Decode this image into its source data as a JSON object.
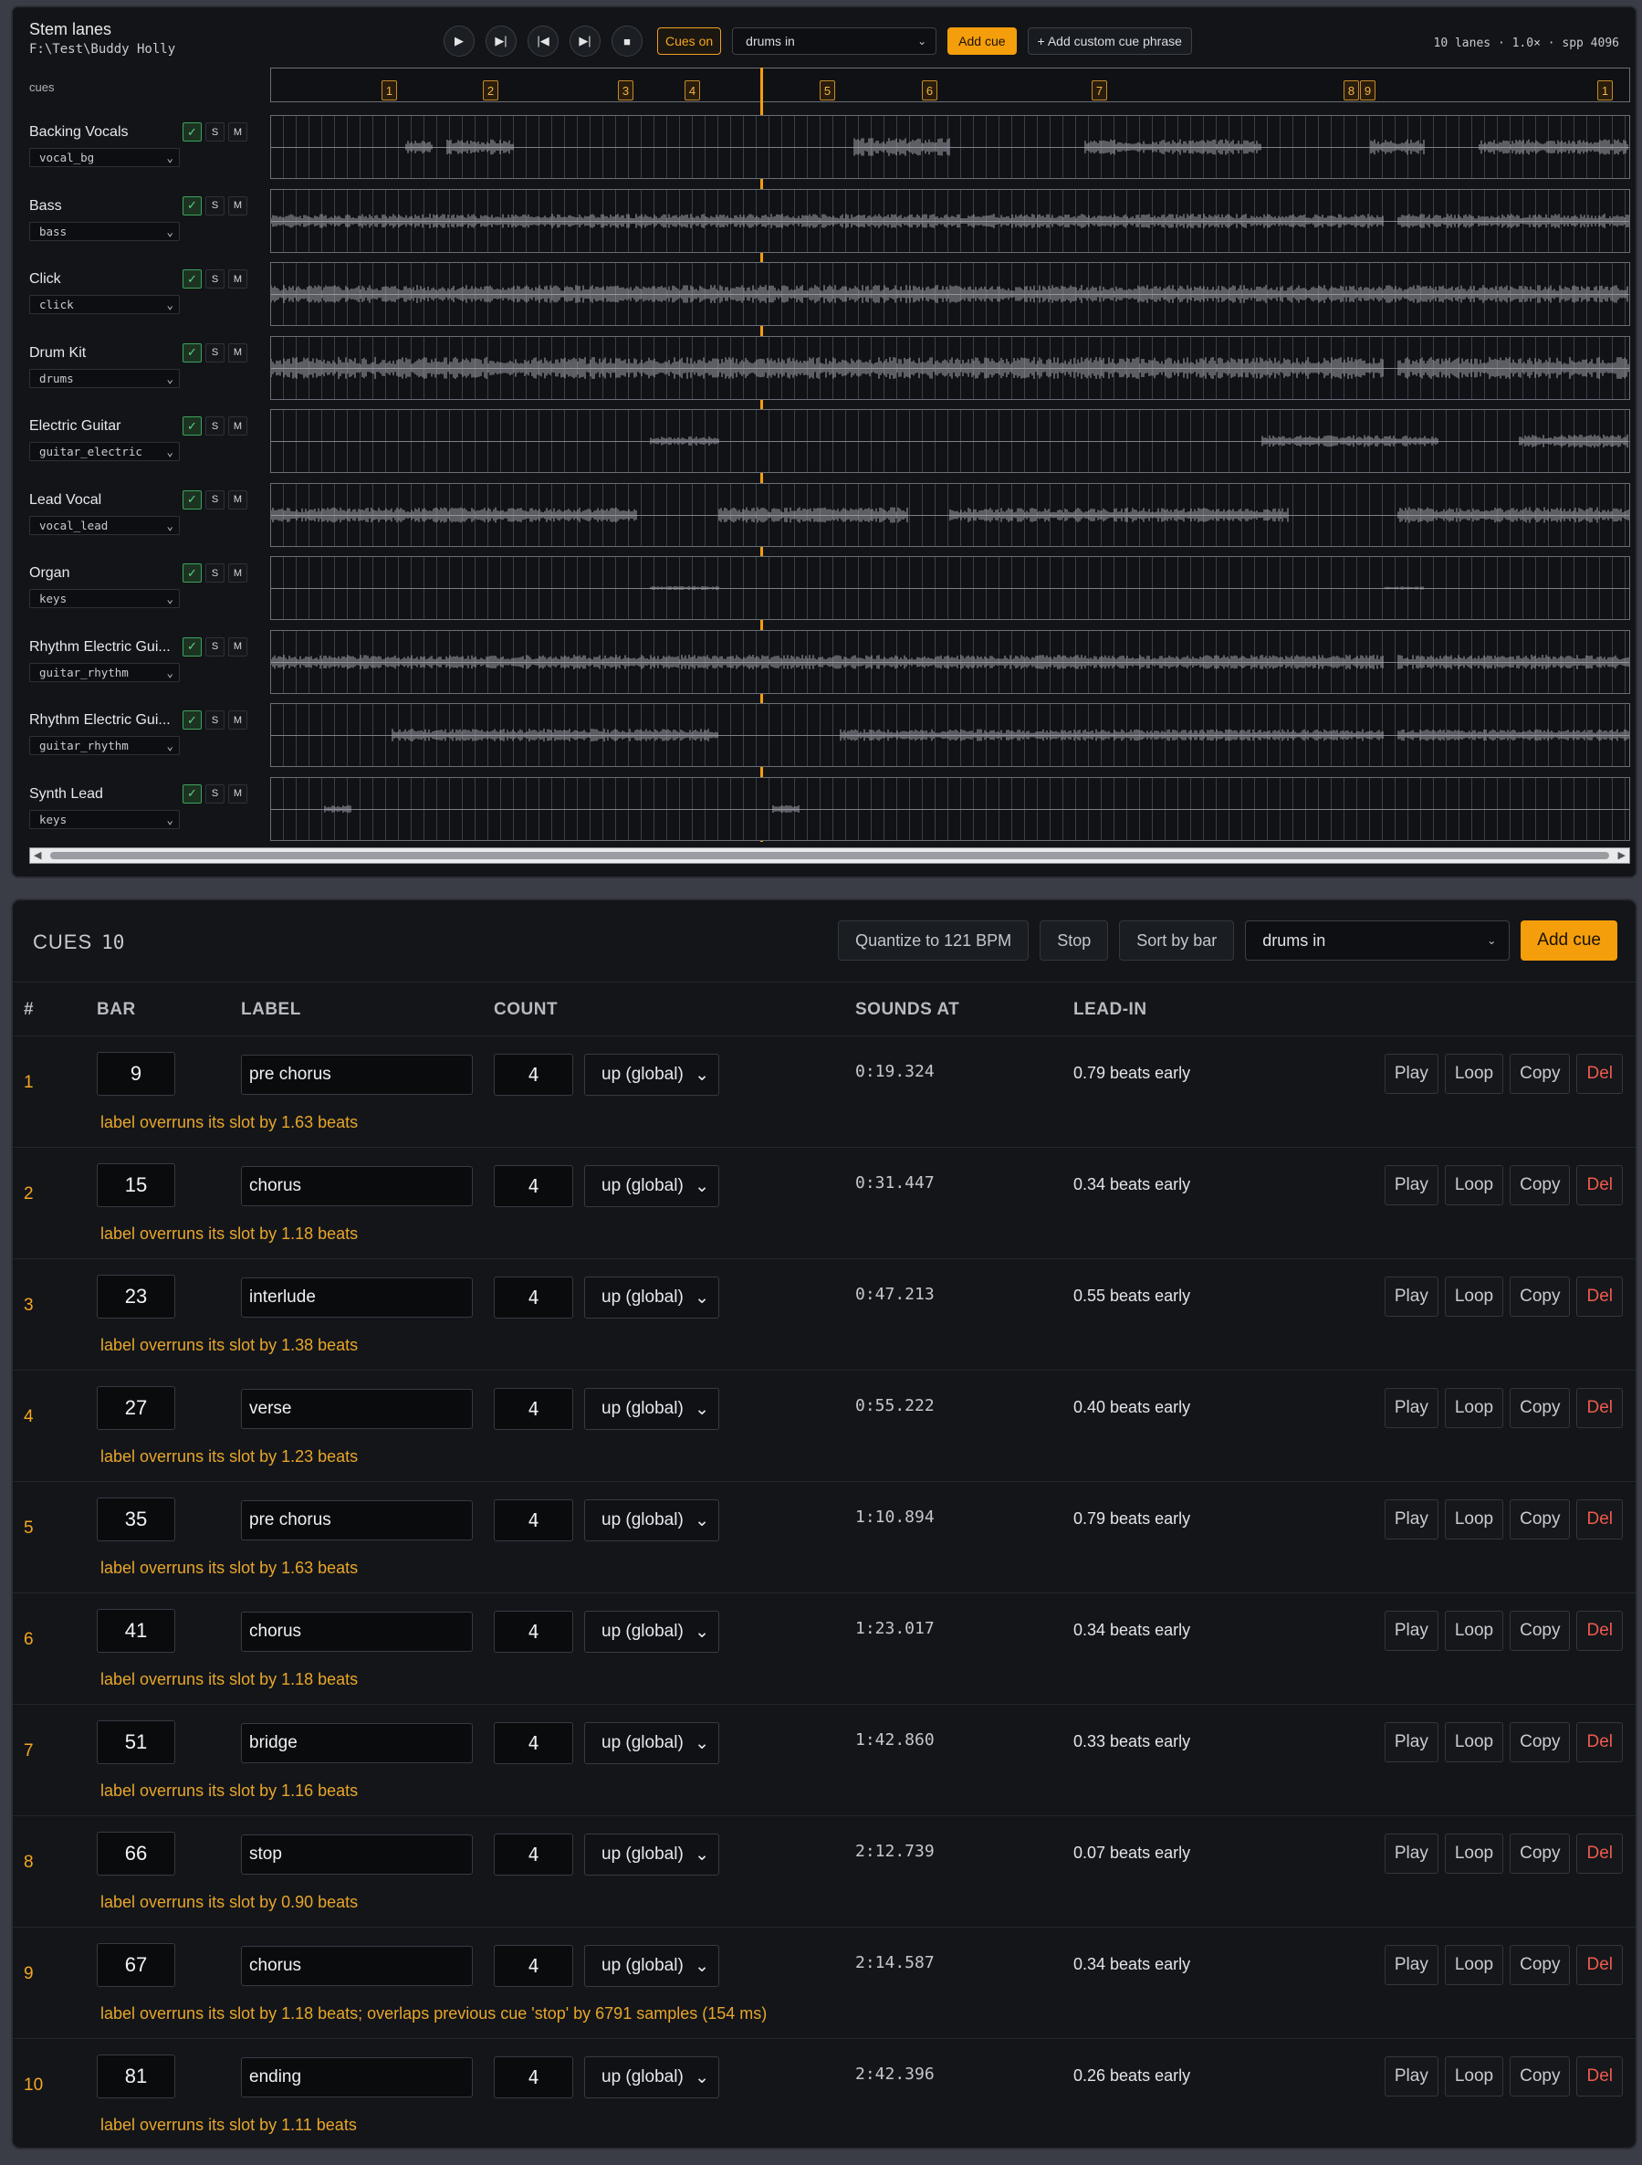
{
  "stem_panel": {
    "title": "Stem lanes",
    "path": "F:\\Test\\Buddy Holly",
    "transport": {
      "play": "▶",
      "play_from_cue": "▶|",
      "prev": "|◀",
      "next": "▶|",
      "stop": "■"
    },
    "cues_toggle": "Cues on",
    "phrase_select": "drums in",
    "add_cue": "Add cue",
    "add_custom": "+ Add custom cue phrase",
    "stats": "10 lanes · 1.0× · spp 4096",
    "cues_label": "cues",
    "cue_markers": [
      "1",
      "2",
      "3",
      "4",
      "5",
      "6",
      "7",
      "8",
      "9",
      "1"
    ],
    "lanes": [
      {
        "name": "Backing Vocals",
        "source": "vocal_bg"
      },
      {
        "name": "Bass",
        "source": "bass"
      },
      {
        "name": "Click",
        "source": "click"
      },
      {
        "name": "Drum Kit",
        "source": "drums"
      },
      {
        "name": "Electric Guitar",
        "source": "guitar_electric"
      },
      {
        "name": "Lead Vocal",
        "source": "vocal_lead"
      },
      {
        "name": "Organ",
        "source": "keys"
      },
      {
        "name": "Rhythm Electric Gui...",
        "source": "guitar_rhythm"
      },
      {
        "name": "Rhythm Electric Gui...",
        "source": "guitar_rhythm"
      },
      {
        "name": "Synth Lead",
        "source": "keys"
      }
    ],
    "lane_buttons": {
      "enabled": "✓",
      "solo": "S",
      "mute": "M"
    },
    "colors": {
      "accent": "#f59e0b",
      "waveform": "#a8abb3",
      "enabled": "#3da45a"
    }
  },
  "cues_panel": {
    "title": "CUES",
    "count": "10",
    "quantize": "Quantize to 121 BPM",
    "stop": "Stop",
    "sort": "Sort by bar",
    "phrase_select": "drums in",
    "add_cue": "Add cue",
    "columns": {
      "num": "#",
      "bar": "BAR",
      "label": "LABEL",
      "count": "COUNT",
      "sounds_at": "SOUNDS AT",
      "lead_in": "LEAD-IN"
    },
    "actions": {
      "play": "Play",
      "loop": "Loop",
      "copy": "Copy",
      "del": "Del"
    },
    "rows": [
      {
        "num": "1",
        "bar": "9",
        "label": "pre chorus",
        "count": "4",
        "direction": "up (global)",
        "sounds_at": "0:19.324",
        "lead_in": "0.79 beats early",
        "warning": "label overruns its slot by 1.63 beats"
      },
      {
        "num": "2",
        "bar": "15",
        "label": "chorus",
        "count": "4",
        "direction": "up (global)",
        "sounds_at": "0:31.447",
        "lead_in": "0.34 beats early",
        "warning": "label overruns its slot by 1.18 beats"
      },
      {
        "num": "3",
        "bar": "23",
        "label": "interlude",
        "count": "4",
        "direction": "up (global)",
        "sounds_at": "0:47.213",
        "lead_in": "0.55 beats early",
        "warning": "label overruns its slot by 1.38 beats"
      },
      {
        "num": "4",
        "bar": "27",
        "label": "verse",
        "count": "4",
        "direction": "up (global)",
        "sounds_at": "0:55.222",
        "lead_in": "0.40 beats early",
        "warning": "label overruns its slot by 1.23 beats"
      },
      {
        "num": "5",
        "bar": "35",
        "label": "pre chorus",
        "count": "4",
        "direction": "up (global)",
        "sounds_at": "1:10.894",
        "lead_in": "0.79 beats early",
        "warning": "label overruns its slot by 1.63 beats"
      },
      {
        "num": "6",
        "bar": "41",
        "label": "chorus",
        "count": "4",
        "direction": "up (global)",
        "sounds_at": "1:23.017",
        "lead_in": "0.34 beats early",
        "warning": "label overruns its slot by 1.18 beats"
      },
      {
        "num": "7",
        "bar": "51",
        "label": "bridge",
        "count": "4",
        "direction": "up (global)",
        "sounds_at": "1:42.860",
        "lead_in": "0.33 beats early",
        "warning": "label overruns its slot by 1.16 beats"
      },
      {
        "num": "8",
        "bar": "66",
        "label": "stop",
        "count": "4",
        "direction": "up (global)",
        "sounds_at": "2:12.739",
        "lead_in": "0.07 beats early",
        "warning": "label overruns its slot by 0.90 beats"
      },
      {
        "num": "9",
        "bar": "67",
        "label": "chorus",
        "count": "4",
        "direction": "up (global)",
        "sounds_at": "2:14.587",
        "lead_in": "0.34 beats early",
        "warning": "label overruns its slot by 1.18 beats; overlaps previous cue 'stop' by 6791 samples (154 ms)"
      },
      {
        "num": "10",
        "bar": "81",
        "label": "ending",
        "count": "4",
        "direction": "up (global)",
        "sounds_at": "2:42.396",
        "lead_in": "0.26 beats early",
        "warning": "label overruns its slot by 1.11 beats"
      }
    ]
  }
}
